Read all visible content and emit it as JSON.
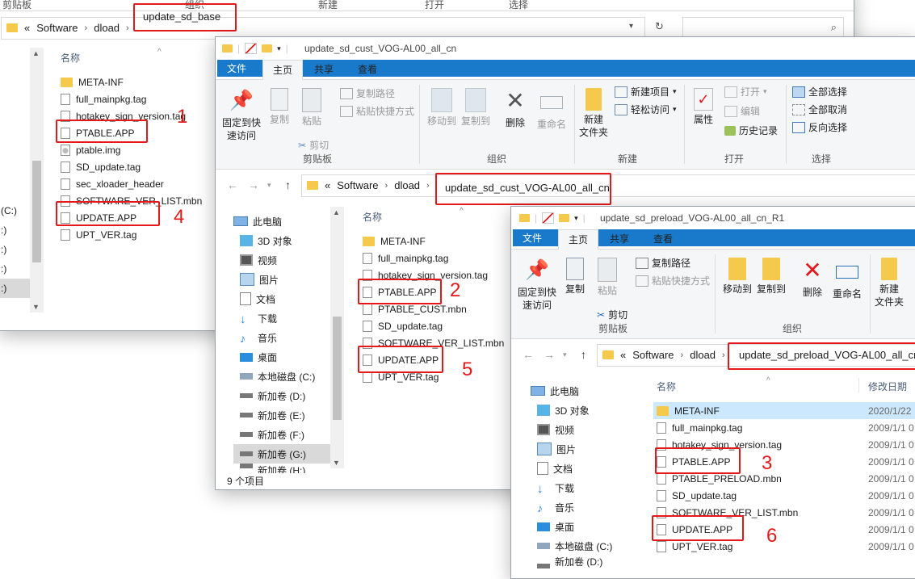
{
  "w1": {
    "top_tabs": [
      "剪贴板",
      "组织",
      "新建",
      "打开",
      "选择"
    ],
    "breadcrumb": [
      "«",
      "Software",
      "dload"
    ],
    "current_folder": "update_sd_base",
    "column_name": "名称",
    "nav_items": [
      "(C:)",
      ":)",
      ":)",
      ":)",
      ":)"
    ],
    "files": [
      "META-INF",
      "full_mainpkg.tag",
      "hotakey_sign_version.tag",
      "PTABLE.APP",
      "ptable.img",
      "SD_update.tag",
      "sec_xloader_header",
      "SOFTWARE_VER_LIST.mbn",
      "UPDATE.APP",
      "UPT_VER.tag"
    ],
    "marks": [
      "1",
      "4"
    ]
  },
  "w2": {
    "title": "update_sd_cust_VOG-AL00_all_cn",
    "tabs": {
      "file": "文件",
      "home": "主页",
      "share": "共享",
      "view": "查看"
    },
    "ribbon": {
      "pin": "固定到快\n速访问",
      "copy": "复制",
      "paste": "粘贴",
      "copy_path": "复制路径",
      "paste_shortcut": "粘贴快捷方式",
      "cut": "剪切",
      "move_to": "移动到",
      "copy_to": "复制到",
      "delete": "删除",
      "rename": "重命名",
      "new_folder": "新建\n文件夹",
      "new_item": "新建项目",
      "easy_access": "轻松访问",
      "properties": "属性",
      "open": "打开",
      "edit": "编辑",
      "history": "历史记录",
      "select_all": "全部选择",
      "select_none": "全部取消",
      "invert": "反向选择",
      "groups": [
        "剪贴板",
        "组织",
        "新建",
        "打开",
        "选择"
      ]
    },
    "breadcrumb": [
      "«",
      "Software",
      "dload"
    ],
    "current_folder": "update_sd_cust_VOG-AL00_all_cn",
    "column_name": "名称",
    "nav_items": [
      "此电脑",
      "3D 对象",
      "视频",
      "图片",
      "文档",
      "下载",
      "音乐",
      "桌面",
      "本地磁盘 (C:)",
      "新加卷 (D:)",
      "新加卷 (E:)",
      "新加卷 (F:)",
      "新加卷 (G:)",
      "新加卷 (H:)"
    ],
    "files": [
      "META-INF",
      "full_mainpkg.tag",
      "hotakey_sign_version.tag",
      "PTABLE.APP",
      "PTABLE_CUST.mbn",
      "SD_update.tag",
      "SOFTWARE_VER_LIST.mbn",
      "UPDATE.APP",
      "UPT_VER.tag"
    ],
    "status": "9 个项目",
    "marks": [
      "2",
      "5"
    ]
  },
  "w3": {
    "title": "update_sd_preload_VOG-AL00_all_cn_R1",
    "tabs": {
      "file": "文件",
      "home": "主页",
      "share": "共享",
      "view": "查看"
    },
    "ribbon": {
      "pin": "固定到快\n速访问",
      "copy": "复制",
      "paste": "粘贴",
      "copy_path": "复制路径",
      "paste_shortcut": "粘贴快捷方式",
      "cut": "剪切",
      "move_to": "移动到",
      "copy_to": "复制到",
      "delete": "删除",
      "rename": "重命名",
      "new_folder": "新建\n文件夹",
      "groups": [
        "剪贴板",
        "组织"
      ]
    },
    "breadcrumb": [
      "«",
      "Software",
      "dload"
    ],
    "current_folder": "update_sd_preload_VOG-AL00_all_cn_",
    "column_name": "名称",
    "column_date": "修改日期",
    "nav_items": [
      "此电脑",
      "3D 对象",
      "视频",
      "图片",
      "文档",
      "下载",
      "音乐",
      "桌面",
      "本地磁盘 (C:)",
      "新加卷 (D:)"
    ],
    "files": [
      {
        "name": "META-INF",
        "date": "2020/1/22"
      },
      {
        "name": "full_mainpkg.tag",
        "date": "2009/1/1 0"
      },
      {
        "name": "hotakey_sign_version.tag",
        "date": "2009/1/1 0"
      },
      {
        "name": "PTABLE.APP",
        "date": "2009/1/1 0"
      },
      {
        "name": "PTABLE_PRELOAD.mbn",
        "date": "2009/1/1 0"
      },
      {
        "name": "SD_update.tag",
        "date": "2009/1/1 0"
      },
      {
        "name": "SOFTWARE_VER_LIST.mbn",
        "date": "2009/1/1 0"
      },
      {
        "name": "UPDATE.APP",
        "date": "2009/1/1 0"
      },
      {
        "name": "UPT_VER.tag",
        "date": "2009/1/1 0"
      }
    ],
    "marks": [
      "3",
      "6"
    ]
  },
  "colors": {
    "accent": "#1979ca",
    "highlight": "#e3191b",
    "folder": "#f5c94c",
    "selection": "#cce8ff"
  }
}
